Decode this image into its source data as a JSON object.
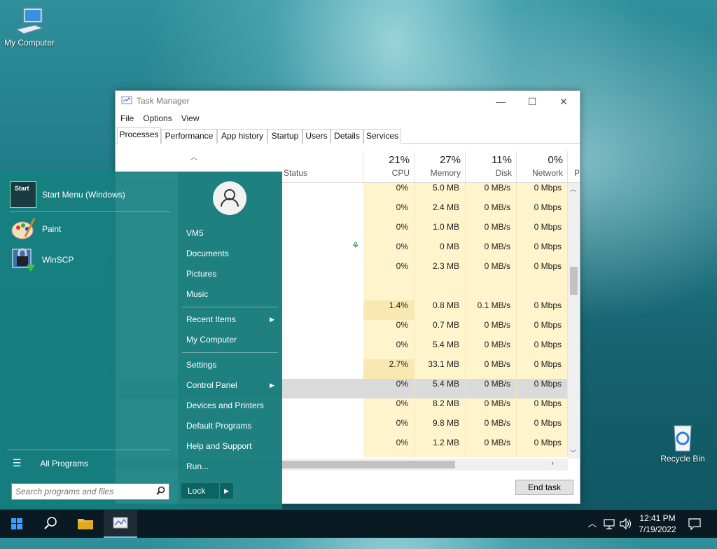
{
  "desktop": {
    "icons": [
      {
        "label": "My Computer"
      },
      {
        "label": "Recycle Bin"
      }
    ]
  },
  "task_manager": {
    "title": "Task Manager",
    "menu": [
      "File",
      "Options",
      "View"
    ],
    "tabs": [
      "Processes",
      "Performance",
      "App history",
      "Startup",
      "Users",
      "Details",
      "Services"
    ],
    "active_tab": "Processes",
    "window_controls": {
      "minimize": "—",
      "maximize": "☐",
      "close": "✕"
    },
    "columns": {
      "status": {
        "label": "Status"
      },
      "cpu": {
        "pct": "21%",
        "label": "CPU"
      },
      "memory": {
        "pct": "27%",
        "label": "Memory"
      },
      "disk": {
        "pct": "11%",
        "label": "Disk"
      },
      "network": {
        "pct": "0%",
        "label": "Network"
      },
      "power": {
        "label": "P"
      }
    },
    "rows": [
      {
        "cpu": "0%",
        "memory": "5.0 MB",
        "disk": "0 MB/s",
        "network": "0 Mbps"
      },
      {
        "cpu": "0%",
        "memory": "2.4 MB",
        "disk": "0 MB/s",
        "network": "0 Mbps"
      },
      {
        "cpu": "0%",
        "memory": "1.0 MB",
        "disk": "0 MB/s",
        "network": "0 Mbps"
      },
      {
        "cpu": "0%",
        "memory": "0 MB",
        "disk": "0 MB/s",
        "network": "0 Mbps"
      },
      {
        "cpu": "0%",
        "memory": "2.3 MB",
        "disk": "0 MB/s",
        "network": "0 Mbps"
      },
      {
        "cpu": "",
        "memory": "",
        "disk": "",
        "network": ""
      },
      {
        "cpu": "1.4%",
        "memory": "0.8 MB",
        "disk": "0.1 MB/s",
        "network": "0 Mbps"
      },
      {
        "cpu": "0%",
        "memory": "0.7 MB",
        "disk": "0 MB/s",
        "network": "0 Mbps"
      },
      {
        "cpu": "0%",
        "memory": "5.4 MB",
        "disk": "0 MB/s",
        "network": "0 Mbps"
      },
      {
        "cpu": "2.7%",
        "memory": "33.1 MB",
        "disk": "0 MB/s",
        "network": "0 Mbps"
      },
      {
        "cpu": "0%",
        "memory": "5.4 MB",
        "disk": "0 MB/s",
        "network": "0 Mbps"
      },
      {
        "cpu": "0%",
        "memory": "8.2 MB",
        "disk": "0 MB/s",
        "network": "0 Mbps"
      },
      {
        "cpu": "0%",
        "memory": "9.8 MB",
        "disk": "0 MB/s",
        "network": "0 Mbps"
      },
      {
        "cpu": "0%",
        "memory": "1.2 MB",
        "disk": "0 MB/s",
        "network": "0 Mbps"
      }
    ],
    "end_task_label": "End task"
  },
  "start_menu": {
    "pinned_apps": [
      {
        "label": "Start Menu (Windows)",
        "icon_text": "Start"
      },
      {
        "label": "Paint"
      },
      {
        "label": "WinSCP"
      }
    ],
    "right_items": [
      {
        "label": "VM5"
      },
      {
        "label": "Documents"
      },
      {
        "label": "Pictures"
      },
      {
        "label": "Music"
      },
      {
        "label": "Recent Items"
      },
      {
        "label": "My Computer"
      },
      {
        "label": "Settings"
      },
      {
        "label": "Control Panel"
      },
      {
        "label": "Devices and Printers"
      },
      {
        "label": "Default Programs"
      },
      {
        "label": "Help and Support"
      },
      {
        "label": "Run..."
      }
    ],
    "all_programs_label": "All Programs",
    "search_placeholder": "Search programs and files",
    "lock_label": "Lock"
  },
  "taskbar": {
    "clock_time": "12:41 PM",
    "clock_date": "7/19/2022"
  },
  "colors": {
    "start_menu_bg": "#178080",
    "cpu_shade": "#fff4cc",
    "taskbar_bg": "#0a1a22"
  }
}
